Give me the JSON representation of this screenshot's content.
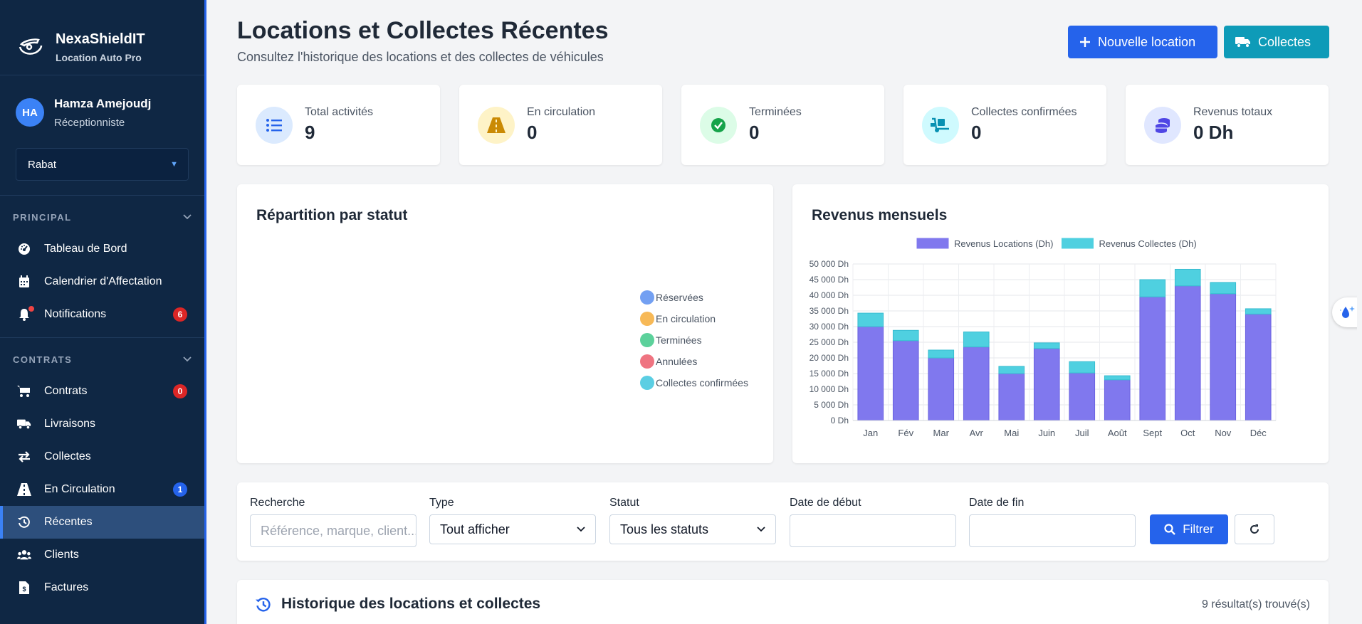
{
  "brand": {
    "name": "NexaShieldIT",
    "subtitle": "Location Auto Pro"
  },
  "user": {
    "initials": "HA",
    "name": "Hamza Amejoudj",
    "role": "Réceptionniste"
  },
  "branch": {
    "selected": "Rabat"
  },
  "sidebar": {
    "sections": [
      {
        "title": "PRINCIPAL",
        "items": [
          {
            "label": "Tableau de Bord",
            "icon": "dashboard-icon"
          },
          {
            "label": "Calendrier d'Affectation",
            "icon": "calendar-icon"
          },
          {
            "label": "Notifications",
            "icon": "bell-icon",
            "badge": "6"
          }
        ]
      },
      {
        "title": "CONTRATS",
        "items": [
          {
            "label": "Contrats",
            "icon": "cart-icon",
            "badge": "0"
          },
          {
            "label": "Livraisons",
            "icon": "truck-icon"
          },
          {
            "label": "Collectes",
            "icon": "exchange-icon"
          },
          {
            "label": "En Circulation",
            "icon": "road-icon",
            "badge": "1"
          },
          {
            "label": "Récentes",
            "icon": "history-icon",
            "active": true
          },
          {
            "label": "Clients",
            "icon": "users-icon"
          },
          {
            "label": "Factures",
            "icon": "invoice-icon"
          }
        ]
      }
    ]
  },
  "header": {
    "title": "Locations et Collectes Récentes",
    "subtitle": "Consultez l'historique des locations et des collectes de véhicules",
    "new_button": "Nouvelle location",
    "collect_button": "Collectes"
  },
  "stats": [
    {
      "label": "Total activités",
      "value": "9",
      "color": "#2563eb",
      "bg": "#dbeafe"
    },
    {
      "label": "En circulation",
      "value": "0",
      "color": "#ca8a04",
      "bg": "#fef3c7"
    },
    {
      "label": "Terminées",
      "value": "0",
      "color": "#16a34a",
      "bg": "#dcfce7"
    },
    {
      "label": "Collectes confirmées",
      "value": "0",
      "color": "#0891b2",
      "bg": "#cffafe"
    },
    {
      "label": "Revenus totaux",
      "value": "0 Dh",
      "color": "#4f46e5",
      "bg": "#e0e7ff"
    }
  ],
  "status_card": {
    "title": "Répartition par statut",
    "legend": [
      {
        "label": "Réservées",
        "color": "#5b8ff0"
      },
      {
        "label": "En circulation",
        "color": "#f6ad3a"
      },
      {
        "label": "Terminées",
        "color": "#3fc98a"
      },
      {
        "label": "Annulées",
        "color": "#ec5c6b"
      },
      {
        "label": "Collectes confirmées",
        "color": "#3ec6de"
      }
    ]
  },
  "revenue_card": {
    "title": "Revenus mensuels"
  },
  "chart_data": {
    "type": "bar",
    "stacked": true,
    "categories": [
      "Jan",
      "Fév",
      "Mar",
      "Avr",
      "Mai",
      "Juin",
      "Juil",
      "Août",
      "Sept",
      "Oct",
      "Nov",
      "Déc"
    ],
    "series": [
      {
        "name": "Revenus Locations (Dh)",
        "color": "#8078ee",
        "values": [
          30000,
          25500,
          20000,
          23500,
          15000,
          23000,
          15200,
          13000,
          39500,
          43000,
          40500,
          34000
        ]
      },
      {
        "name": "Revenus Collectes (Dh)",
        "color": "#4fd0e0",
        "values": [
          4300,
          3300,
          2500,
          4800,
          2300,
          1800,
          3600,
          1300,
          5500,
          5300,
          3600,
          1700
        ]
      }
    ],
    "yticks": [
      "50 000 Dh",
      "45 000 Dh",
      "40 000 Dh",
      "35 000 Dh",
      "30 000 Dh",
      "25 000 Dh",
      "20 000 Dh",
      "15 000 Dh",
      "10 000 Dh",
      "5 000 Dh",
      "0 Dh"
    ],
    "ylim": [
      0,
      50000
    ],
    "grid": true,
    "legend_position": "top"
  },
  "filters": {
    "search_label": "Recherche",
    "search_placeholder": "Référence, marque, client...",
    "type_label": "Type",
    "type_value": "Tout afficher",
    "status_label": "Statut",
    "status_value": "Tous les statuts",
    "start_label": "Date de début",
    "end_label": "Date de fin",
    "filter_button": "Filtrer"
  },
  "history": {
    "title": "Historique des locations et collectes",
    "count": "9 résultat(s) trouvé(s)"
  }
}
